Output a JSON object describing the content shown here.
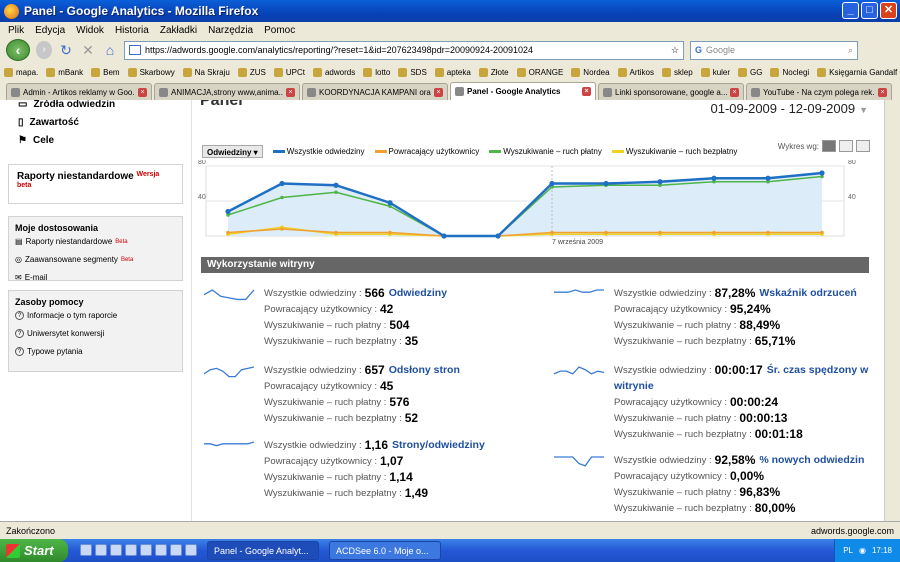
{
  "window": {
    "title": "Panel - Google Analytics - Mozilla Firefox"
  },
  "menu": [
    "Plik",
    "Edycja",
    "Widok",
    "Historia",
    "Zakładki",
    "Narzędzia",
    "Pomoc"
  ],
  "nav": {
    "url": "https://adwords.google.com/analytics/reporting/?reset=1&id=207623498pdr=20090924-20091024",
    "search_placeholder": "Google"
  },
  "bookmarks": [
    "mapa.",
    "mBank",
    "Bem",
    "Skarbowy",
    "Na Skraju",
    "ZUS",
    "UPCt",
    "adwords",
    "lotto",
    "SDS",
    "apteka",
    "Złote",
    "ORANGE",
    "Nordea",
    "Artikos",
    "sklep",
    "kuler",
    "GG",
    "Noclegi",
    "Księgarnia Gandalf"
  ],
  "tabs": [
    {
      "label": "Admin - Artikos reklamy w Goo..."
    },
    {
      "label": "ANIMACJA,strony www,anima..."
    },
    {
      "label": "KOORDYNACJA KAMPANI ora..."
    },
    {
      "label": "Panel - Google Analytics"
    },
    {
      "label": "Linki sponsorowane, google a..."
    },
    {
      "label": "YouTube - Na czym polega rek..."
    }
  ],
  "sidebar": {
    "top": [
      "Źródła odwiedzin",
      "Zawartość",
      "Cele"
    ],
    "custom_reports": {
      "label": "Raporty niestandardowe",
      "tag": "Wersja beta"
    },
    "moje": {
      "title": "Moje dostosowania",
      "items": [
        {
          "label": "Raporty niestandardowe",
          "beta": "Beta"
        },
        {
          "label": "Zaawansowane segmenty",
          "beta": "Beta"
        },
        {
          "label": "E-mail",
          "beta": ""
        }
      ]
    },
    "zasoby": {
      "title": "Zasoby pomocy",
      "items": [
        "Informacje o tym raporcie",
        "Uniwersytet konwersji",
        "Typowe pytania"
      ]
    }
  },
  "main": {
    "title": "Panel",
    "date_range": "01-09-2009 - 12-09-2009",
    "dropdown": "Odwiedziny",
    "legend": [
      "Wszystkie odwiedziny",
      "Powracający użytkownicy",
      "Wyszukiwanie – ruch płatny",
      "Wyszukiwanie – ruch bezpłatny"
    ],
    "wykres_label": "Wykres wg:",
    "section_title": "Wykorzystanie witryny",
    "metrics_left": [
      {
        "name": "Odwiedziny",
        "rows": [
          {
            "label": "Wszystkie odwiedziny :",
            "value": "566"
          },
          {
            "label": "Powracający użytkownicy :",
            "value": "42"
          },
          {
            "label": "Wyszukiwanie – ruch płatny :",
            "value": "504"
          },
          {
            "label": "Wyszukiwanie – ruch bezpłatny :",
            "value": "35"
          }
        ]
      },
      {
        "name": "Odsłony stron",
        "rows": [
          {
            "label": "Wszystkie odwiedziny :",
            "value": "657"
          },
          {
            "label": "Powracający użytkownicy :",
            "value": "45"
          },
          {
            "label": "Wyszukiwanie – ruch płatny :",
            "value": "576"
          },
          {
            "label": "Wyszukiwanie – ruch bezpłatny :",
            "value": "52"
          }
        ]
      },
      {
        "name": "Strony/odwiedziny",
        "rows": [
          {
            "label": "Wszystkie odwiedziny :",
            "value": "1,16"
          },
          {
            "label": "Powracający użytkownicy :",
            "value": "1,07"
          },
          {
            "label": "Wyszukiwanie – ruch płatny :",
            "value": "1,14"
          },
          {
            "label": "Wyszukiwanie – ruch bezpłatny :",
            "value": "1,49"
          }
        ]
      }
    ],
    "metrics_right": [
      {
        "name": "Wskaźnik odrzuceń",
        "rows": [
          {
            "label": "Wszystkie odwiedziny :",
            "value": "87,28%"
          },
          {
            "label": "Powracający użytkownicy :",
            "value": "95,24%"
          },
          {
            "label": "Wyszukiwanie – ruch płatny :",
            "value": "88,49%"
          },
          {
            "label": "Wyszukiwanie – ruch bezpłatny :",
            "value": "65,71%"
          }
        ]
      },
      {
        "name": "Śr. czas spędzony w",
        "name2": "witrynie",
        "rows": [
          {
            "label": "Wszystkie odwiedziny :",
            "value": "00:00:17"
          },
          {
            "label": "Powracający użytkownicy :",
            "value": "00:00:24"
          },
          {
            "label": "Wyszukiwanie – ruch płatny :",
            "value": "00:00:13"
          },
          {
            "label": "Wyszukiwanie – ruch bezpłatny :",
            "value": "00:01:18"
          }
        ]
      },
      {
        "name": "% nowych odwiedzin",
        "rows": [
          {
            "label": "Wszystkie odwiedziny :",
            "value": "92,58%"
          },
          {
            "label": "Powracający użytkownicy :",
            "value": "0,00%"
          },
          {
            "label": "Wyszukiwanie – ruch płatny :",
            "value": "96,83%"
          },
          {
            "label": "Wyszukiwanie – ruch bezpłatny :",
            "value": "80,00%"
          }
        ]
      }
    ]
  },
  "status": {
    "left": "Zakończono",
    "right": "adwords.google.com"
  },
  "taskbar": {
    "start": "Start",
    "tasks": [
      "Panel - Google Analyt...",
      "ACDSee 6.0 - Moje o..."
    ],
    "lang": "PL",
    "time": "17:18"
  },
  "chart_data": {
    "type": "line",
    "x": [
      "1 wrz",
      "2 wrz",
      "3 wrz",
      "4 wrz",
      "5 wrz",
      "6 wrz",
      "7 wrz",
      "8 wrz",
      "9 wrz",
      "10 wrz",
      "11 wrz",
      "12 wrz"
    ],
    "ylim": [
      0,
      80
    ],
    "y_ticks": [
      "40",
      "80"
    ],
    "annotation": "7 września 2009",
    "colors": [
      "#1f6fc4",
      "#f0a030",
      "#4fb548",
      "#f0d020"
    ],
    "series": [
      {
        "name": "Wszystkie odwiedziny",
        "values": [
          28,
          60,
          58,
          38,
          0,
          0,
          60,
          60,
          62,
          66,
          66,
          72
        ]
      },
      {
        "name": "Powracający użytkownicy",
        "values": [
          4,
          8,
          4,
          4,
          0,
          0,
          4,
          4,
          4,
          4,
          4,
          4
        ]
      },
      {
        "name": "Wyszukiwanie – ruch płatny",
        "values": [
          24,
          44,
          50,
          34,
          0,
          0,
          56,
          58,
          58,
          62,
          62,
          68
        ]
      },
      {
        "name": "Wyszukiwanie – ruch bezpłatny",
        "values": [
          2,
          10,
          2,
          2,
          0,
          0,
          2,
          2,
          2,
          2,
          2,
          2
        ]
      }
    ]
  },
  "sparklines": [
    [
      4,
      7,
      3,
      2,
      1,
      1,
      7
    ],
    [
      3,
      6,
      7,
      5,
      1,
      1,
      6,
      7,
      8
    ],
    [
      5,
      5,
      4,
      5,
      5,
      5,
      5,
      5,
      6
    ],
    [
      4,
      4,
      4,
      5,
      4,
      4,
      5,
      5
    ],
    [
      3,
      5,
      5,
      3,
      8,
      6,
      3,
      5,
      4
    ],
    [
      5,
      5,
      5,
      5,
      2,
      1,
      5,
      5,
      5
    ]
  ]
}
